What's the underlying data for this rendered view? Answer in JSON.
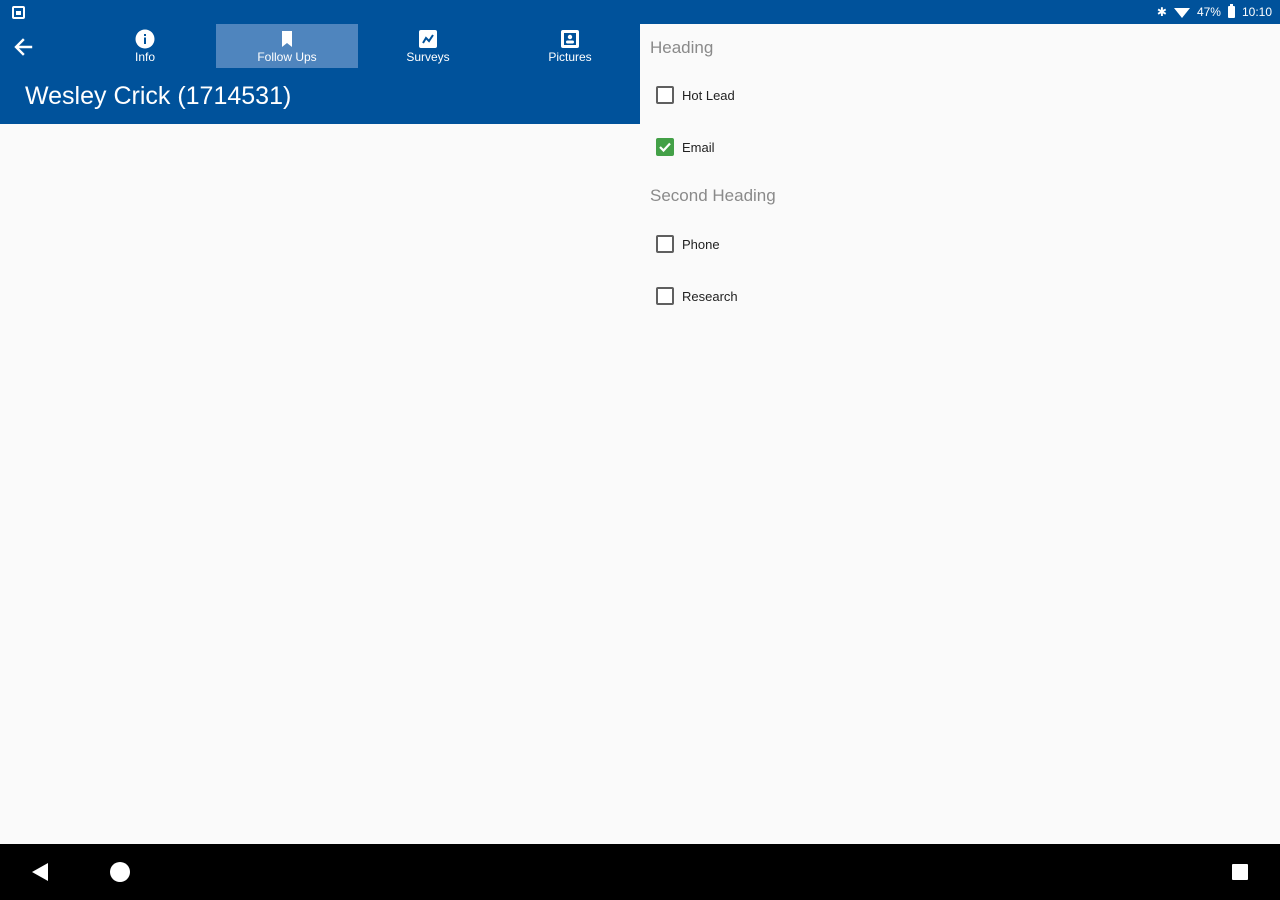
{
  "status_bar": {
    "battery": "47%",
    "time": "10:10"
  },
  "app_bar": {
    "title": "Wesley Crick (1714531)",
    "tabs": [
      {
        "label": "Info",
        "icon": "info-icon",
        "active": false
      },
      {
        "label": "Follow Ups",
        "icon": "bookmark-icon",
        "active": true
      },
      {
        "label": "Surveys",
        "icon": "survey-icon",
        "active": false
      },
      {
        "label": "Pictures",
        "icon": "picture-icon",
        "active": false
      }
    ]
  },
  "panel": {
    "sections": [
      {
        "heading": "Heading",
        "items": [
          {
            "label": "Hot Lead",
            "checked": false
          },
          {
            "label": "Email",
            "checked": true
          }
        ]
      },
      {
        "heading": "Second Heading",
        "items": [
          {
            "label": "Phone",
            "checked": false
          },
          {
            "label": "Research",
            "checked": false
          }
        ]
      }
    ]
  },
  "colors": {
    "primary": "#00529b",
    "active_tab": "#4f85be",
    "check_green": "#43a047"
  }
}
